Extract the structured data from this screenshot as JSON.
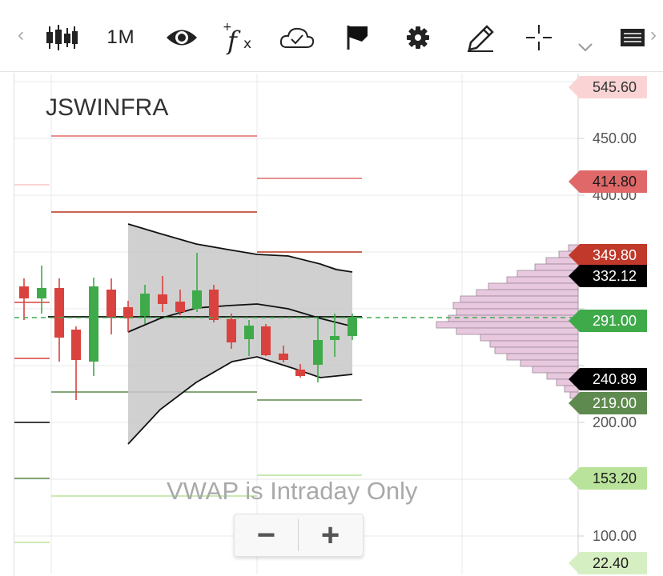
{
  "toolbar": {
    "left_arrow": "‹",
    "right_arrow": "›",
    "timeframe_label": "1M"
  },
  "chart": {
    "symbol": "JSWINFRA",
    "notice": "VWAP is Intraday Only",
    "zoom_out_label": "−",
    "zoom_in_label": "+",
    "axis_labels": [
      "450.00",
      "400.00",
      "200.00",
      "100.00"
    ],
    "price_tags": [
      {
        "label": "545.60",
        "bg": "#fad4d4",
        "fg": "#333333"
      },
      {
        "label": "414.80",
        "bg": "#e06868",
        "fg": "#1a1a1a"
      },
      {
        "label": "349.80",
        "bg": "#c0392b",
        "fg": "#ffffff"
      },
      {
        "label": "332.12",
        "bg": "#000000",
        "fg": "#ffffff"
      },
      {
        "label": "291.00",
        "bg": "#3faa4a",
        "fg": "#ffffff"
      },
      {
        "label": "240.89",
        "bg": "#000000",
        "fg": "#ffffff"
      },
      {
        "label": "219.00",
        "bg": "#5e8a4f",
        "fg": "#ffffff"
      },
      {
        "label": "153.20",
        "bg": "#b9e39a",
        "fg": "#1a1a1a"
      },
      {
        "label": "22.40",
        "bg": "#d6efc2",
        "fg": "#1a1a1a"
      }
    ],
    "colors": {
      "up": "#3faa4a",
      "down": "#d9423e",
      "band_fill": "#c8c8c8",
      "volume_profile": "#e8c8df"
    }
  }
}
